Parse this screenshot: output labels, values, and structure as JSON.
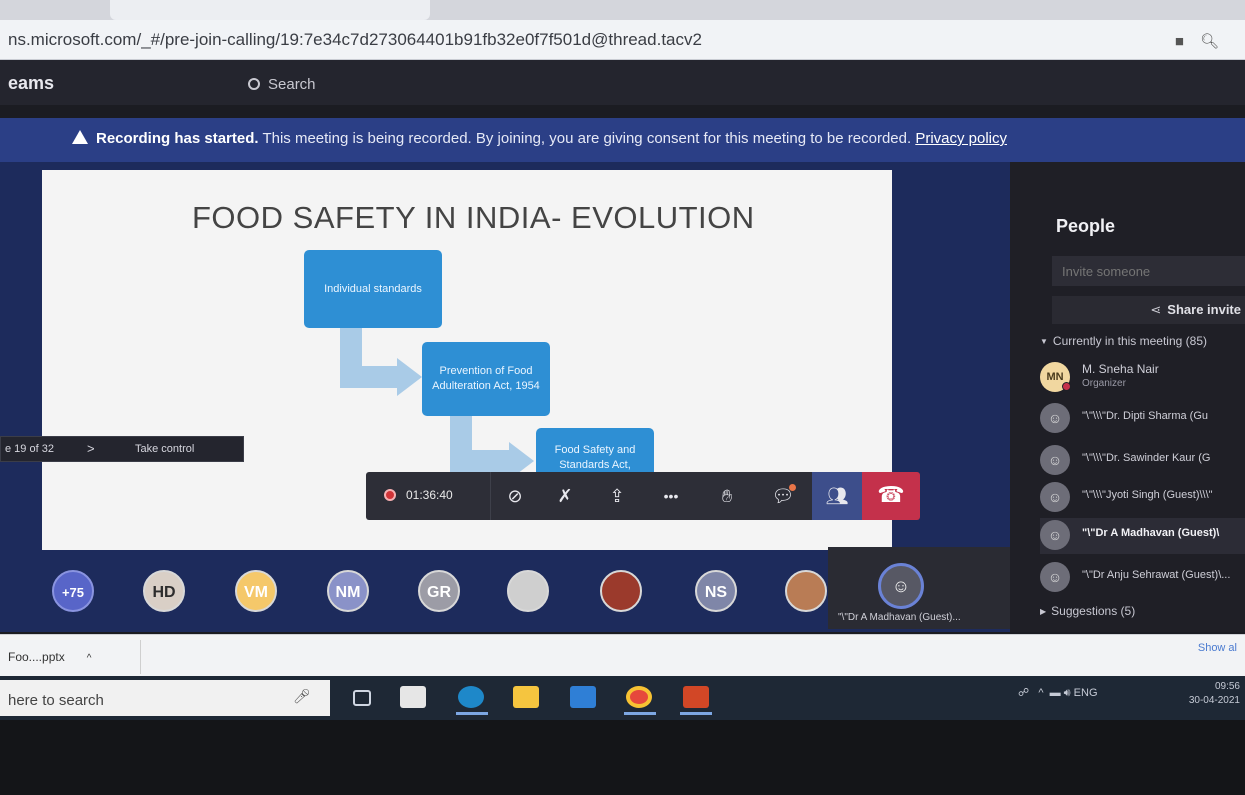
{
  "browser": {
    "url": "ns.microsoft.com/_#/pre-join-calling/19:7e34c7d273064401b91fb32e0f7f501d@thread.tacv2",
    "icons": [
      "camera-icon",
      "zoom-icon"
    ]
  },
  "teams": {
    "app_name": "eams",
    "search_placeholder": "Search"
  },
  "banner": {
    "strong": "Recording has started.",
    "message": " This meeting is being recorded. By joining, you are giving consent for this meeting to be recorded. ",
    "link": "Privacy policy"
  },
  "slide": {
    "title": "FOOD SAFETY IN INDIA- EVOLUTION",
    "boxes": [
      "Individual standards",
      "Prevention of Food Adulteration Act, 1954",
      "Food Safety and Standards Act,"
    ],
    "box_color": "#2e8fd4",
    "arrow_color": "#a9cbe7"
  },
  "presenter_controls": {
    "page": "e 19 of 32",
    "next": ">",
    "take_control": "Take control"
  },
  "call_bar": {
    "timer": "01:36:40",
    "buttons": [
      "camera-off-icon",
      "mic-off-icon",
      "share-screen-icon",
      "more-icon",
      "raise-hand-icon",
      "chat-icon",
      "people-icon",
      "hang-up-icon"
    ],
    "more_label": "•••",
    "leave_color": "#c4314b"
  },
  "gallery": {
    "overflow": "+75",
    "initials": [
      "HD",
      "VM",
      "NM",
      "GR",
      "NS"
    ],
    "speaker_name": "\"\\\"Dr A Madhavan (Guest)..."
  },
  "people": {
    "title": "People",
    "invite_placeholder": "Invite someone",
    "share_invite": "Share invite",
    "current_label": "Currently in this meeting (85)",
    "participants": [
      {
        "initials": "MN",
        "name": "M. Sneha Nair",
        "role": "Organizer"
      },
      {
        "name": "\"\\\"\\\\\\\"Dr. Dipti Sharma (Gu"
      },
      {
        "name": "\"\\\"\\\\\\\"Dr. Sawinder Kaur (G"
      },
      {
        "name": "\"\\\"\\\\\\\"Jyoti Singh (Guest)\\\\\\\""
      },
      {
        "name": "\"\\\"Dr A Madhavan (Guest)\\"
      },
      {
        "name": "\"\\\"Dr Anju Sehrawat (Guest)\\..."
      }
    ],
    "suggestions_label": "Suggestions (5)"
  },
  "downloads": {
    "file": "Foo....pptx",
    "chevron": "^",
    "show_all": "Show al"
  },
  "taskbar": {
    "search_text": "here to search",
    "tray_lang": "ENG",
    "time": "09:56",
    "date": "30-04-2021"
  }
}
